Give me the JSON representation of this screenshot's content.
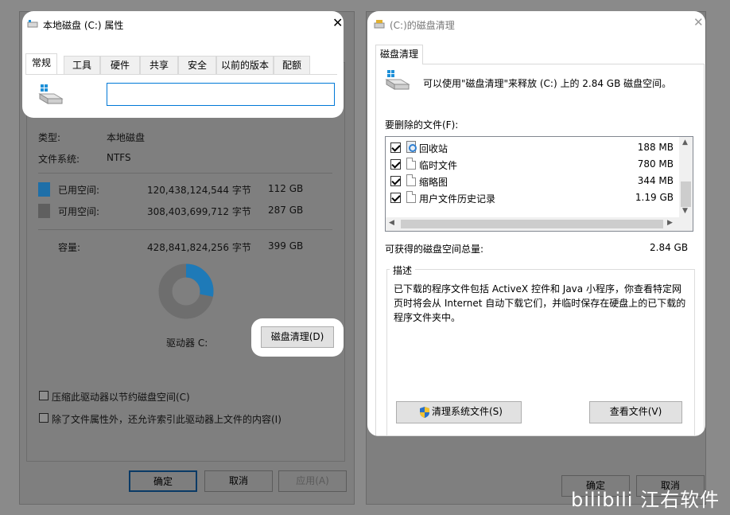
{
  "left_window": {
    "title": "本地磁盘 (C:) 属性",
    "tabs": [
      "常规",
      "工具",
      "硬件",
      "共享",
      "安全",
      "以前的版本",
      "配额"
    ],
    "name_value": "",
    "type_label": "类型:",
    "type_value": "本地磁盘",
    "fs_label": "文件系统:",
    "fs_value": "NTFS",
    "used_label": "已用空间:",
    "used_bytes": "120,438,124,544 字节",
    "used_size": "112 GB",
    "free_label": "可用空间:",
    "free_bytes": "308,403,699,712 字节",
    "free_size": "287 GB",
    "cap_label": "容量:",
    "cap_bytes": "428,841,824,256 字节",
    "cap_size": "399 GB",
    "used_fraction": 0.281,
    "drive_label": "驱动器 C:",
    "cleanup_button": "磁盘清理(D)",
    "compress_option": "压缩此驱动器以节约磁盘空间(C)",
    "index_option": "除了文件属性外，还允许索引此驱动器上文件的内容(I)",
    "ok_button": "确定",
    "cancel_button": "取消",
    "apply_button": "应用(A)",
    "colors": {
      "used": "#1e7ab8",
      "free": "#6e6e6e"
    }
  },
  "right_window": {
    "title": "(C:)的磁盘清理",
    "tab": "磁盘清理",
    "intro": "可以使用\"磁盘清理\"来释放  (C:) 上的 2.84 GB 磁盘空间。",
    "files_label": "要删除的文件(F):",
    "files": [
      {
        "name": "回收站",
        "size": "188 MB",
        "icon": "recycle-bin-icon"
      },
      {
        "name": "临时文件",
        "size": "780 MB",
        "icon": "file-icon"
      },
      {
        "name": "缩略图",
        "size": "344 MB",
        "icon": "file-icon"
      },
      {
        "name": "用户文件历史记录",
        "size": "1.19 GB",
        "icon": "file-icon"
      }
    ],
    "total_label": "可获得的磁盘空间总量:",
    "total_value": "2.84 GB",
    "desc_title": "描述",
    "desc_text": "已下载的程序文件包括 ActiveX 控件和 Java 小程序，你查看特定网页时将会从 Internet 自动下载它们，并临时保存在硬盘上的已下载的程序文件夹中。",
    "system_button": "清理系统文件(S)",
    "view_button": "查看文件(V)",
    "ok_button": "确定",
    "cancel_button": "取消"
  },
  "watermark": "bilibili 江右软件"
}
